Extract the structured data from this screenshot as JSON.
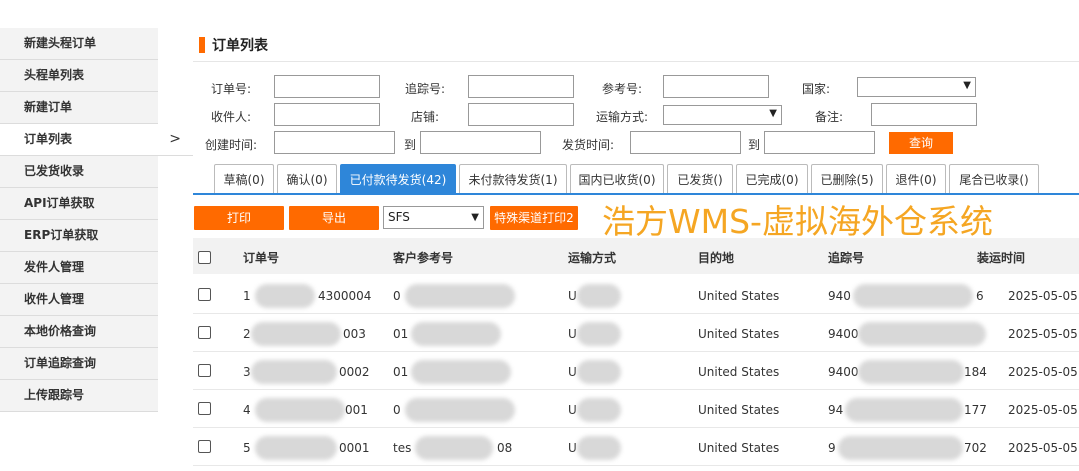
{
  "sidebar": {
    "items": [
      {
        "label": "新建头程订单"
      },
      {
        "label": "头程单列表"
      },
      {
        "label": "新建订单"
      },
      {
        "label": "订单列表"
      },
      {
        "label": "已发货收录"
      },
      {
        "label": "API订单获取"
      },
      {
        "label": "ERP订单获取"
      },
      {
        "label": "发件人管理"
      },
      {
        "label": "收件人管理"
      },
      {
        "label": "本地价格查询"
      },
      {
        "label": "订单追踪查询"
      },
      {
        "label": "上传跟踪号"
      }
    ],
    "chevron": ">"
  },
  "page_title": "订单列表",
  "filters": {
    "order_no": "订单号:",
    "tracking_no": "追踪号:",
    "reference_no": "参考号:",
    "country": "国家:",
    "recipient": "收件人:",
    "store": "店铺:",
    "shipping_method": "运输方式:",
    "remark": "备注:",
    "created_time": "创建时间:",
    "to1": "到",
    "ship_time": "发货时间:",
    "to2": "到",
    "query_button": "查询"
  },
  "tabs": [
    {
      "label": "草稿(0)"
    },
    {
      "label": "确认(0)"
    },
    {
      "label": "已付款待发货(42)"
    },
    {
      "label": "未付款待发货(1)"
    },
    {
      "label": "国内已收货(0)"
    },
    {
      "label": "已发货()"
    },
    {
      "label": "已完成(0)"
    },
    {
      "label": "已删除(5)"
    },
    {
      "label": "退件(0)"
    },
    {
      "label": "尾合已收录()"
    }
  ],
  "active_tab": "已付款待发货(42)",
  "actions": {
    "print": "打印",
    "export": "导出",
    "channel_value": "SFS",
    "special_print": "特殊渠道打印2"
  },
  "watermark": "浩方WMS-虚拟海外仓系统",
  "table": {
    "headers": [
      "订单号",
      "客户参考号",
      "运输方式",
      "目的地",
      "追踪号",
      "装运时间"
    ],
    "rows": [
      {
        "order_prefix": "1",
        "order_suffix": "4300004",
        "ref_prefix": "0",
        "ref_suffix": "",
        "ship": "U",
        "dest": "United States",
        "track_prefix": "940",
        "track_suffix": "6",
        "date": "2025-05-05"
      },
      {
        "order_prefix": "2",
        "order_suffix": "003",
        "ref_prefix": "01",
        "ref_suffix": "",
        "ship": "U",
        "dest": "United States",
        "track_prefix": "9400",
        "track_suffix": "",
        "date": "2025-05-05"
      },
      {
        "order_prefix": "3",
        "order_suffix": "0002",
        "ref_prefix": "01",
        "ref_suffix": "",
        "ship": "U",
        "dest": "United States",
        "track_prefix": "9400",
        "track_suffix": "184",
        "date": "2025-05-05"
      },
      {
        "order_prefix": "4",
        "order_suffix": "001",
        "ref_prefix": "0",
        "ref_suffix": "",
        "ship": "U",
        "dest": "United States",
        "track_prefix": "94",
        "track_suffix": "177",
        "date": "2025-05-05"
      },
      {
        "order_prefix": "5",
        "order_suffix": "0001",
        "ref_prefix": "tes",
        "ref_suffix": "08",
        "ship": "U",
        "dest": "United States",
        "track_prefix": "9",
        "track_suffix": "702",
        "date": "2025-05-05"
      }
    ]
  },
  "colors": {
    "accent": "#ff6a00",
    "tab_active": "#2e86d9",
    "watermark": "#f5a623"
  }
}
